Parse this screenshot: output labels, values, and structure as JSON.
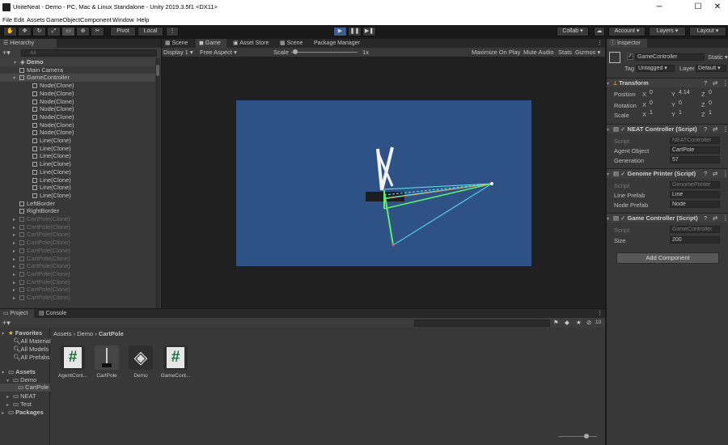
{
  "titlebar": {
    "title": "UniteNeat - Demo - PC, Mac & Linux Standalone - Unity 2019.3.5f1 <DX11>",
    "minimize": "─",
    "maximize": "☐",
    "close": "✕"
  },
  "menu": [
    "File",
    "Edit",
    "Assets",
    "GameObject",
    "Component",
    "Window",
    "Help"
  ],
  "toolbar": {
    "pivot": "Pivot",
    "local": "Local",
    "collab": "Collab ▾",
    "account": "Account ▾",
    "layers": "Layers ▾",
    "layout": "Layout ▾"
  },
  "hierarchy": {
    "title": "Hierarchy",
    "search_placeholder": "All",
    "scene": "Demo",
    "items": [
      {
        "label": "Main Camera",
        "indent": 1,
        "dim": false,
        "sel": false
      },
      {
        "label": "GameController",
        "indent": 1,
        "dim": false,
        "sel": true,
        "exp": true
      },
      {
        "label": "Node(Clone)",
        "indent": 2
      },
      {
        "label": "Node(Clone)",
        "indent": 2
      },
      {
        "label": "Node(Clone)",
        "indent": 2
      },
      {
        "label": "Node(Clone)",
        "indent": 2
      },
      {
        "label": "Node(Clone)",
        "indent": 2
      },
      {
        "label": "Node(Clone)",
        "indent": 2
      },
      {
        "label": "Node(Clone)",
        "indent": 2
      },
      {
        "label": "Line(Clone)",
        "indent": 2
      },
      {
        "label": "Line(Clone)",
        "indent": 2
      },
      {
        "label": "Line(Clone)",
        "indent": 2
      },
      {
        "label": "Line(Clone)",
        "indent": 2
      },
      {
        "label": "Line(Clone)",
        "indent": 2
      },
      {
        "label": "Line(Clone)",
        "indent": 2
      },
      {
        "label": "Line(Clone)",
        "indent": 2
      },
      {
        "label": "Line(Clone)",
        "indent": 2
      },
      {
        "label": "LeftBorder",
        "indent": 1
      },
      {
        "label": "RightBorder",
        "indent": 1
      },
      {
        "label": "CartPole(Clone)",
        "indent": 1,
        "dim": true,
        "col": true
      },
      {
        "label": "CartPole(Clone)",
        "indent": 1,
        "dim": true,
        "col": true
      },
      {
        "label": "CartPole(Clone)",
        "indent": 1,
        "dim": true,
        "col": true
      },
      {
        "label": "CartPole(Clone)",
        "indent": 1,
        "dim": true,
        "col": true
      },
      {
        "label": "CartPole(Clone)",
        "indent": 1,
        "dim": true,
        "col": true
      },
      {
        "label": "CartPole(Clone)",
        "indent": 1,
        "dim": true,
        "col": true
      },
      {
        "label": "CartPole(Clone)",
        "indent": 1,
        "dim": true,
        "col": true
      },
      {
        "label": "CartPole(Clone)",
        "indent": 1,
        "dim": true,
        "col": true
      },
      {
        "label": "CartPole(Clone)",
        "indent": 1,
        "dim": true,
        "col": true
      },
      {
        "label": "CartPole(Clone)",
        "indent": 1,
        "dim": true,
        "col": true
      },
      {
        "label": "CartPole(Clone)",
        "indent": 1,
        "dim": true,
        "col": true
      }
    ]
  },
  "center_tabs": [
    "Scene",
    "Game",
    "Asset Store",
    "Scene",
    "Package Manager"
  ],
  "game_bar": {
    "display": "Display 1 ▾",
    "aspect": "Free Aspect ▾",
    "scale_label": "Scale",
    "scale_value": "1x",
    "maximize": "Maximize On Play",
    "mute": "Mute Audio",
    "stats": "Stats",
    "gizmos": "Gizmos ▾"
  },
  "colors": {
    "game_bg": "#2e5286",
    "line_cyan": "#62e8f2",
    "line_green": "#5cf06a",
    "line_white": "#f3f3f3"
  },
  "inspector": {
    "title": "Inspector",
    "object_name": "GameController",
    "static": "Static ▾",
    "tag_label": "Tag",
    "tag_value": "Untagged ▾",
    "layer_label": "Layer",
    "layer_value": "Default ▾",
    "transform": {
      "title": "Transform",
      "position": "Position",
      "rotation": "Rotation",
      "scale": "Scale",
      "pos": [
        "0",
        "4.14",
        "0"
      ],
      "rot": [
        "0",
        "0",
        "0"
      ],
      "scl": [
        "1",
        "1",
        "1"
      ],
      "axes": [
        "X",
        "Y",
        "Z"
      ]
    },
    "neat": {
      "title": "NEAT Controller (Script)",
      "script_label": "Script",
      "script_value": "NEATController",
      "agent_label": "Agent Object",
      "agent_value": "CartPole",
      "gen_label": "Generation",
      "gen_value": "57"
    },
    "genome": {
      "title": "Genome Printer (Script)",
      "script_label": "Script",
      "script_value": "GenomePrinter",
      "line_label": "Line Prefab",
      "line_value": "Line",
      "node_label": "Node Prefab",
      "node_value": "Node"
    },
    "gamecontroller": {
      "title": "Game Controller (Script)",
      "script_label": "Script",
      "script_value": "GameController",
      "size_label": "Size",
      "size_value": "200"
    },
    "add_component": "Add Component"
  },
  "project": {
    "tabs": [
      "Project",
      "Console"
    ],
    "favorites": "Favorites",
    "fav_items": [
      "All Material",
      "All Models",
      "All Prefabs"
    ],
    "assets": "Assets",
    "tree": [
      "Demo",
      "CartPole",
      "NEAT",
      "Test"
    ],
    "packages": "Packages",
    "breadcrumb": [
      "Assets",
      "Demo",
      "CartPole"
    ],
    "hidden_count": "10",
    "files": [
      {
        "name": "AgentCont...",
        "icon": "csharp-script-icon"
      },
      {
        "name": "CartPole",
        "icon": "prefab-icon"
      },
      {
        "name": "Demo",
        "icon": "unity-scene-icon"
      },
      {
        "name": "GameCont...",
        "icon": "csharp-script-icon"
      }
    ]
  }
}
